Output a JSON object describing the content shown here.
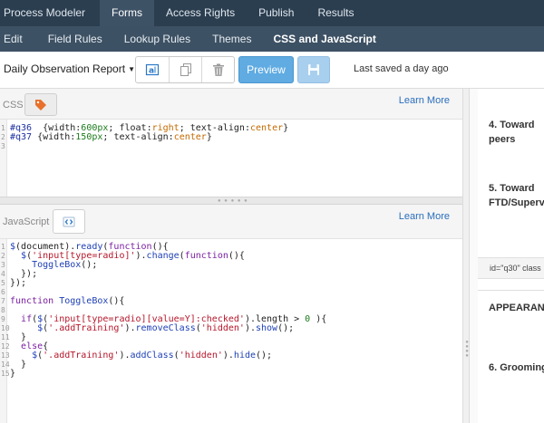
{
  "top_nav": {
    "tabs": [
      {
        "label": "Process Modeler",
        "active": false
      },
      {
        "label": "Forms",
        "active": true
      },
      {
        "label": "Access Rights",
        "active": false
      },
      {
        "label": "Publish",
        "active": false
      },
      {
        "label": "Results",
        "active": false
      }
    ]
  },
  "sub_nav": {
    "tabs": [
      {
        "label": "Edit",
        "active": false
      },
      {
        "label": "Field Rules",
        "active": false
      },
      {
        "label": "Lookup Rules",
        "active": false
      },
      {
        "label": "Themes",
        "active": false
      },
      {
        "label": "CSS and JavaScript",
        "active": true
      }
    ]
  },
  "toolbar": {
    "report_name": "Daily Observation Report",
    "preview_label": "Preview",
    "last_saved": "Last saved a day ago"
  },
  "css_panel": {
    "label": "CSS",
    "learn_more": "Learn More",
    "lines": [
      {
        "n": "1",
        "html": "<span class='c-sel'>#q36</span>  {<span class='c-prop'>width</span>:<span class='c-num'>600px</span>; <span class='c-prop'>float</span>:<span class='c-val'>right</span>; <span class='c-prop'>text-align</span>:<span class='c-val'>center</span>}"
      },
      {
        "n": "2",
        "html": "<span class='c-sel'>#q37</span> {<span class='c-prop'>width</span>:<span class='c-num'>150px</span>; <span class='c-prop'>text-align</span>:<span class='c-val'>center</span>}"
      },
      {
        "n": "3",
        "html": ""
      }
    ]
  },
  "js_panel": {
    "label": "JavaScript",
    "learn_more": "Learn More",
    "lines": [
      {
        "n": "1",
        "html": "<span class='c-fn'>$</span>(document).<span class='c-fn'>ready</span>(<span class='c-kw'>function</span>(){"
      },
      {
        "n": "2",
        "html": "  <span class='c-fn'>$</span>(<span class='c-str'>'input[type=radio]'</span>).<span class='c-fn'>change</span>(<span class='c-kw'>function</span>(){"
      },
      {
        "n": "3",
        "html": "    <span class='c-fn'>ToggleBox</span>();"
      },
      {
        "n": "4",
        "html": "  });"
      },
      {
        "n": "5",
        "html": "});"
      },
      {
        "n": "6",
        "html": ""
      },
      {
        "n": "7",
        "html": "<span class='c-kw'>function</span> <span class='c-fn'>ToggleBox</span>(){"
      },
      {
        "n": "8",
        "html": ""
      },
      {
        "n": "9",
        "html": "  <span class='c-kw'>if</span>(<span class='c-fn'>$</span>(<span class='c-str'>'input[type=radio][value=Y]:checked'</span>).length &gt; <span class='c-num'>0</span> ){"
      },
      {
        "n": "10",
        "html": "     <span class='c-fn'>$</span>(<span class='c-str'>'.addTraining'</span>).<span class='c-fn'>removeClass</span>(<span class='c-str'>'hidden'</span>).<span class='c-fn'>show</span>();"
      },
      {
        "n": "11",
        "html": "  }"
      },
      {
        "n": "12",
        "html": "  <span class='c-kw'>else</span>{"
      },
      {
        "n": "13",
        "html": "    <span class='c-fn'>$</span>(<span class='c-str'>'.addTraining'</span>).<span class='c-fn'>addClass</span>(<span class='c-str'>'hidden'</span>).<span class='c-fn'>hide</span>();"
      },
      {
        "n": "14",
        "html": "  }"
      },
      {
        "n": "15",
        "html": "}"
      }
    ]
  },
  "preview_pane": {
    "q4_line1": "4. Toward",
    "q4_line2": "peers",
    "q5_line1": "5. Toward",
    "q5_line2": "FTD/Supervisor",
    "id_snippet": "id=\"q30\" class",
    "appearance": "APPEARANCE",
    "q6": "6. Grooming"
  },
  "colors": {
    "top_nav_bg": "#2b3e50",
    "sub_nav_bg": "#3d5164",
    "preview_button": "#5fabe2",
    "link": "#2a6ebd"
  }
}
